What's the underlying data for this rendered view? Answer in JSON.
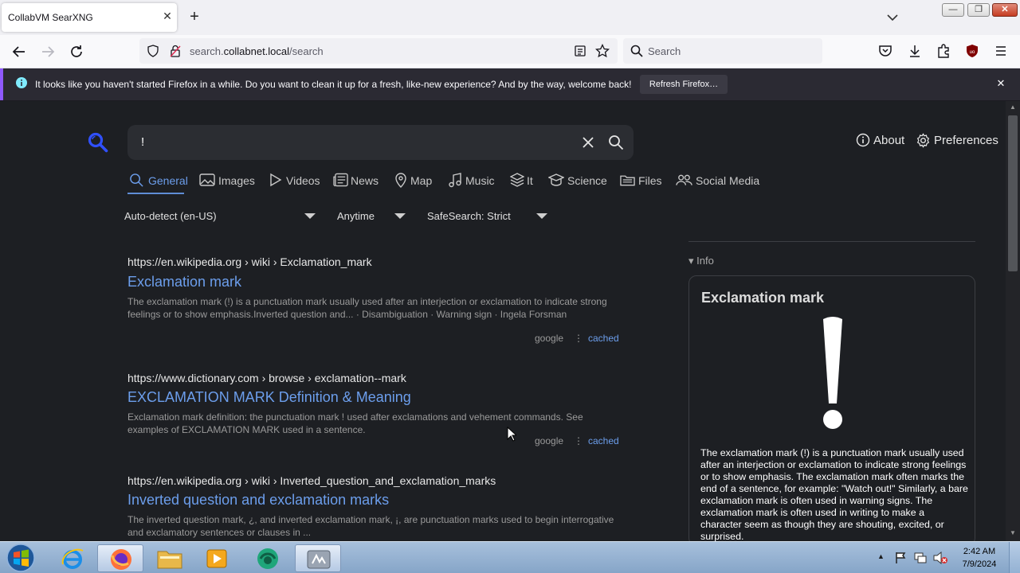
{
  "browser": {
    "tab_title": "CollabVM SearXNG",
    "tab_close": "✕",
    "new_tab": "+",
    "window": {
      "minimize": "—",
      "maximize": "❐",
      "close": "✕"
    },
    "url_host_prefix": "search.",
    "url_host": "collabnet.local",
    "url_path": "/search",
    "search_placeholder": "Search",
    "notification": {
      "text": "It looks like you haven't started Firefox in a while. Do you want to clean it up for a fresh, like-new experience? And by the way, welcome back!",
      "button": "Refresh Firefox…",
      "close": "✕"
    }
  },
  "searx": {
    "query": "!",
    "about": "About",
    "preferences": "Preferences",
    "categories": [
      {
        "label": "General",
        "icon": "search-icon",
        "active": true
      },
      {
        "label": "Images",
        "icon": "image-icon"
      },
      {
        "label": "Videos",
        "icon": "play-icon"
      },
      {
        "label": "News",
        "icon": "newspaper-icon"
      },
      {
        "label": "Map",
        "icon": "map-pin-icon"
      },
      {
        "label": "Music",
        "icon": "music-note-icon"
      },
      {
        "label": "It",
        "icon": "layers-icon"
      },
      {
        "label": "Science",
        "icon": "graduation-cap-icon"
      },
      {
        "label": "Files",
        "icon": "folder-icon"
      },
      {
        "label": "Social Media",
        "icon": "people-icon"
      }
    ],
    "filters": {
      "language": "Auto-detect (en-US)",
      "time": "Anytime",
      "safesearch": "SafeSearch: Strict"
    },
    "results": [
      {
        "url": "https://en.wikipedia.org",
        "path": " › wiki › Exclamation_mark",
        "title": "Exclamation mark",
        "snippet": "The exclamation mark (!) is a punctuation mark usually used after an interjection or exclamation to indicate strong feelings or to show emphasis.Inverted question and... · Disambiguation · Warning sign · Ingela Forsman",
        "engine": "google",
        "cached": "cached"
      },
      {
        "url": "https://www.dictionary.com",
        "path": " › browse › exclamation--mark",
        "title": "EXCLAMATION MARK Definition & Meaning",
        "snippet": "Exclamation mark definition: the punctuation mark ! used after exclamations and vehement commands. See examples of EXCLAMATION MARK used in a sentence.",
        "engine": "google",
        "cached": "cached"
      },
      {
        "url": "https://en.wikipedia.org",
        "path": " › wiki › Inverted_question_and_exclamation_marks",
        "title": "Inverted question and exclamation marks",
        "snippet": "The inverted question mark, ¿, and inverted exclamation mark, ¡, are punctuation marks used to begin interrogative and exclamatory sentences or clauses in ..."
      }
    ],
    "info": {
      "heading": "▾ Info",
      "title": "Exclamation mark",
      "glyph": "!",
      "body": "The exclamation mark (!) is a punctuation mark usually used after an interjection or exclamation to indicate strong feelings or to show emphasis. The exclamation mark often marks the end of a sentence, for example: \"Watch out!\" Similarly, a bare exclamation mark is often used in warning signs. The exclamation mark is often used in writing to make a character seem as though they are shouting, excited, or surprised."
    }
  },
  "taskbar": {
    "time": "2:42 AM",
    "date": "7/9/2024"
  }
}
